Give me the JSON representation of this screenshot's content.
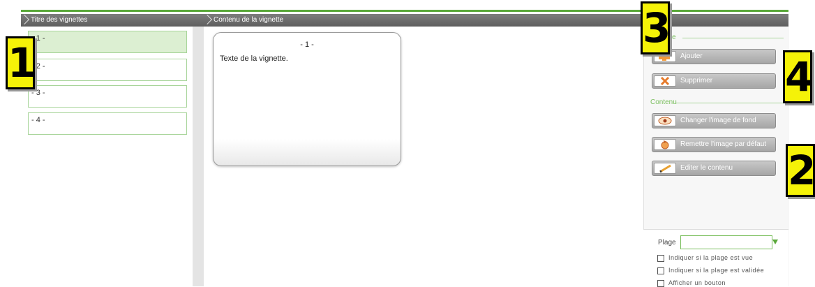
{
  "headers": {
    "left": "Titre des vignettes",
    "main": "Contenu de la vignette"
  },
  "vignettes": [
    "- 1 -",
    "- 2 -",
    "- 3 -",
    "- 4 -"
  ],
  "card": {
    "title": "- 1 -",
    "body": "Texte de la vignette."
  },
  "right": {
    "section_vignette": "Vignette",
    "section_contenu": "Contenu",
    "buttons": {
      "ajouter": "Ajouter",
      "supprimer": "Supprimer",
      "changer": "Changer l'image de fond",
      "remettre": "Remettre l'image par défaut",
      "editer": "Editer le contenu"
    }
  },
  "callouts": [
    "1",
    "2",
    "3",
    "4"
  ],
  "bottom": {
    "plage_label": "Plage",
    "plage_value": "",
    "check1": "Indiquer si la plage est vue",
    "check2": "Indiquer si la plage est validée",
    "check3": "Afficher un bouton"
  },
  "colors": {
    "accent": "#5aa83a",
    "header": "#6e6e6e",
    "callout": "#f5f208"
  }
}
